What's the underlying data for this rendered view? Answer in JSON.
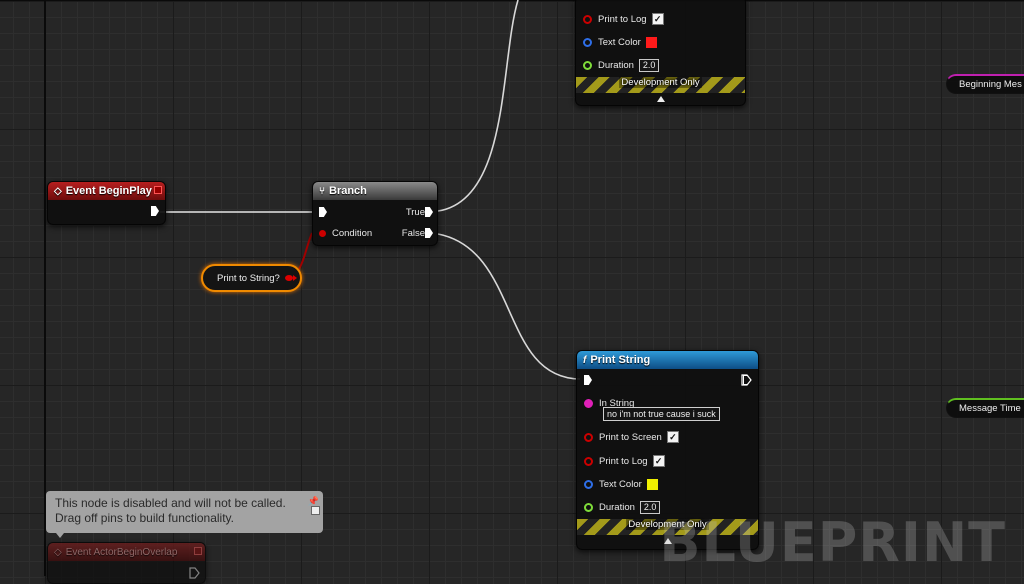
{
  "watermark": "BLUEPRINT",
  "nodes": {
    "event_begin_play": {
      "title": "Event BeginPlay"
    },
    "branch": {
      "title": "Branch",
      "pins": {
        "condition": "Condition",
        "true": "True",
        "false": "False"
      }
    },
    "variable": {
      "label": "Print to String?"
    },
    "print_string_top": {
      "print_to_log": "Print to Log",
      "text_color": "Text Color",
      "duration": "Duration",
      "duration_value": "2.0",
      "development_only": "Development Only",
      "text_color_hex": "#ff1a1a"
    },
    "print_string_bottom": {
      "title": "Print String",
      "in_string": "In String",
      "in_string_value": "no i'm not true cause i suck",
      "print_to_screen": "Print to Screen",
      "print_to_log": "Print to Log",
      "text_color": "Text Color",
      "duration": "Duration",
      "duration_value": "2.0",
      "development_only": "Development Only",
      "text_color_hex": "#f0f000"
    },
    "event_actor_begin_overlap": {
      "title": "Event ActorBeginOverlap"
    }
  },
  "right_pills": {
    "beginning": "Beginning Mes",
    "message_time": "Message Time"
  },
  "tooltip": {
    "line1": "This node is disabled and will not be called.",
    "line2": "Drag off pins to build functionality."
  },
  "colors": {
    "event_red": "#b61f1f",
    "function_blue": "#2f9ad8",
    "bool_pin": "#cc0000",
    "string_pin": "#e020b8",
    "wire": "#e0e0e0"
  }
}
